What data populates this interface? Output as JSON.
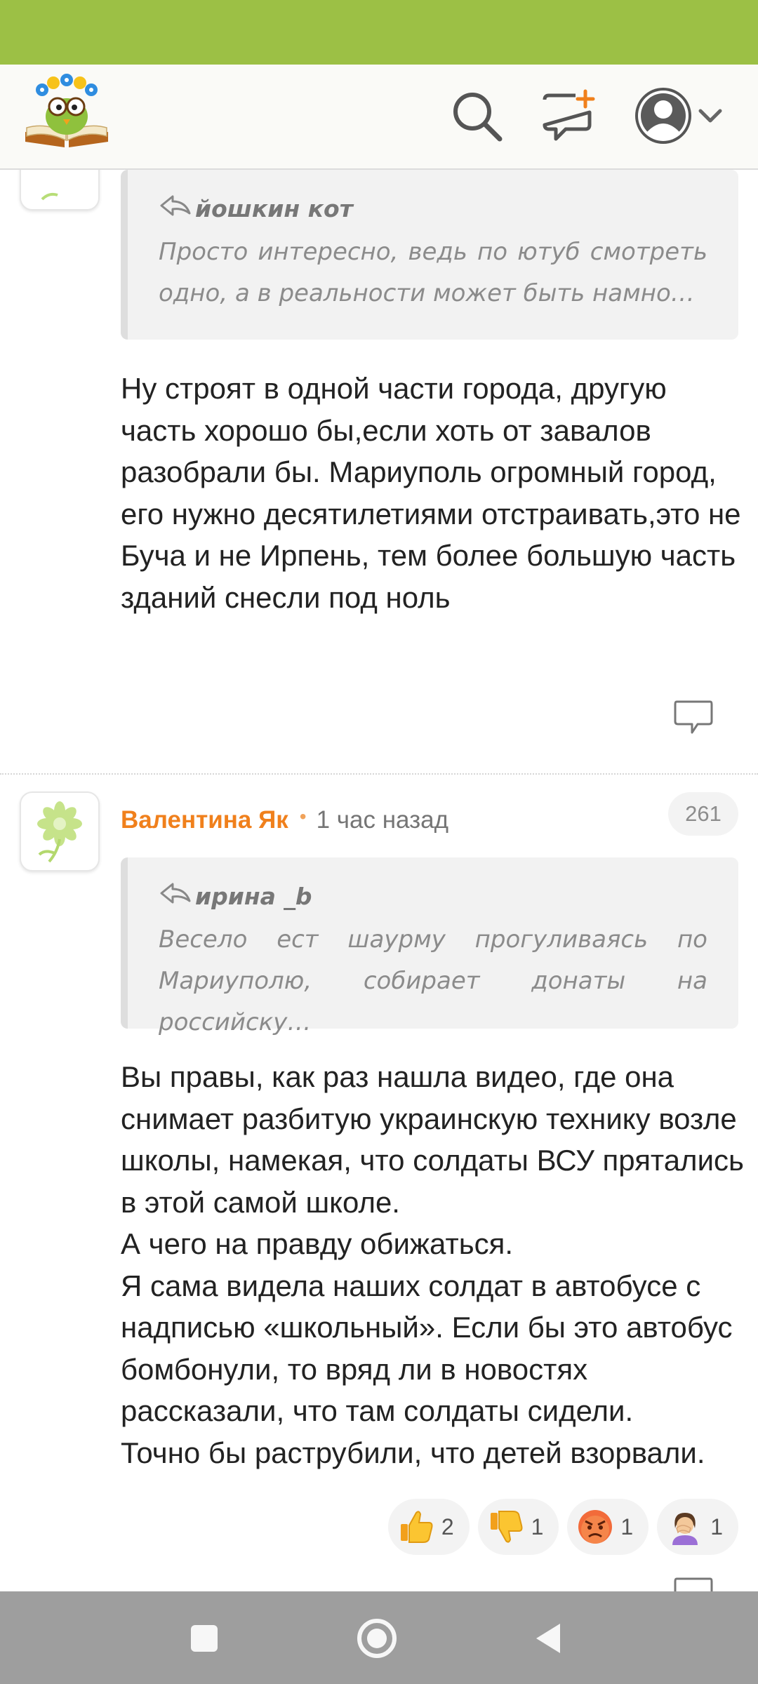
{
  "colors": {
    "status_bar": "#9cc045",
    "author": "#f0801c",
    "nav_bar": "#9e9e9e"
  },
  "header": {
    "logo": "book-owl-logo",
    "icons": [
      "search-icon",
      "compose-icon",
      "profile-avatar-icon",
      "chevron-down-icon"
    ]
  },
  "comments": [
    {
      "quote": {
        "author": "йошкин кот",
        "text": "Просто интересно, ведь по ютуб смотреть одно, а в реальности может быть намно…"
      },
      "text": "Ну строят в одной части города, другую часть хорошо бы,если хоть от завалов разобрали бы. Мариуполь огромный город, его нужно десятилетиями отстраивать,это не Буча и не Ирпень, тем более большую часть зданий снесли под ноль",
      "reply_icon": "reply-bubble-icon"
    },
    {
      "author": "Валентина Як",
      "time": "1 час назад",
      "rating": "261",
      "quote": {
        "author": "ирина _b",
        "text": "Весело ест шаурму прогуливаясь по Мариуполю, собирает донаты на российску…"
      },
      "text": "Вы правы, как раз нашла видео, где она снимает разбитую украинскую технику возле школы, намекая, что солдаты ВСУ прятались в этой самой школе.\nА чего на правду обижаться.\nЯ сама видела наших солдат в автобусе с надписью «школьный». Если бы это автобус бомбонули, то вряд ли в новостях рассказали, что там солдаты сидели.\nТочно бы раструбили, что детей взорвали.",
      "reactions": [
        {
          "icon": "thumbs-up-icon",
          "count": "2"
        },
        {
          "icon": "thumbs-down-icon",
          "count": "1"
        },
        {
          "icon": "angry-face-icon",
          "count": "1"
        },
        {
          "icon": "facepalm-icon",
          "count": "1"
        }
      ]
    }
  ],
  "nav": {
    "icons": [
      "recents-square-icon",
      "home-circle-icon",
      "back-triangle-icon"
    ]
  }
}
